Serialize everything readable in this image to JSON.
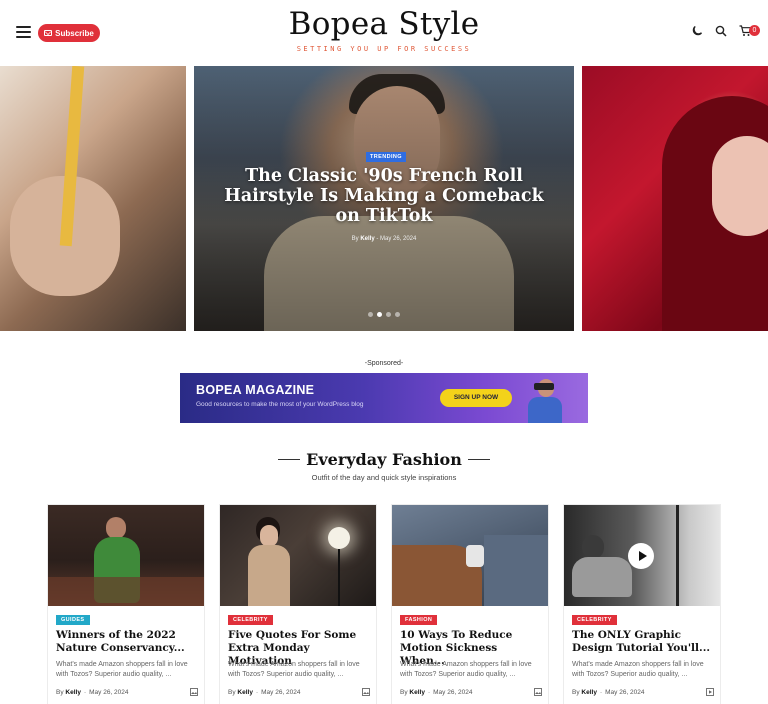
{
  "header": {
    "subscribe_label": "Subscribe",
    "logo": "Bopea Style",
    "tagline": "SETTING YOU UP FOR SUCCESS",
    "cart_count": "0",
    "icons": [
      "menu-icon",
      "mail-icon",
      "moon-icon",
      "search-icon",
      "cart-icon"
    ]
  },
  "hero": {
    "badge": "TRENDING",
    "badge_color": "#2f6de1",
    "title": "The Classic '90s French Roll Hairstyle Is Making a Comeback on TikTok",
    "by": "By",
    "author": "Kelly",
    "date": "May 26, 2024",
    "active_slide": 1,
    "slide_count": 4
  },
  "sponsored": {
    "label": "-Sponsored-",
    "banner_title": "BOPEA MAGAZINE",
    "banner_sub": "Good resources to make the most of your WordPress blog",
    "banner_cta": "SIGN UP NOW"
  },
  "section": {
    "title": "Everyday Fashion",
    "subtitle": "Outfit of the day and quick style inspirations"
  },
  "cards": [
    {
      "badge": "GUIDES",
      "badge_color": "#22a8c8",
      "title": "Winners of the 2022 Nature Conservancy...",
      "excerpt": "What's made Amazon shoppers fall in love with Tozos? Superior audio quality, ...",
      "by": "By",
      "author": "Kelly",
      "date": "May 26, 2024"
    },
    {
      "badge": "CELEBRITY",
      "badge_color": "#e0303a",
      "title": "Five Quotes For Some Extra Monday Motivation",
      "excerpt": "What's made Amazon shoppers fall in love with Tozos? Superior audio quality, ...",
      "by": "By",
      "author": "Kelly",
      "date": "May 26, 2024"
    },
    {
      "badge": "FASHION",
      "badge_color": "#e0303a",
      "title": "10 Ways To Reduce Motion Sickness When...",
      "excerpt": "What's made Amazon shoppers fall in love with Tozos? Superior audio quality, ...",
      "by": "By",
      "author": "Kelly",
      "date": "May 26, 2024"
    },
    {
      "badge": "CELEBRITY",
      "badge_color": "#e0303a",
      "title": "The ONLY Graphic Design Tutorial You'll...",
      "excerpt": "What's made Amazon shoppers fall in love with Tozos? Superior audio quality, ...",
      "by": "By",
      "author": "Kelly",
      "date": "May 26, 2024"
    }
  ]
}
